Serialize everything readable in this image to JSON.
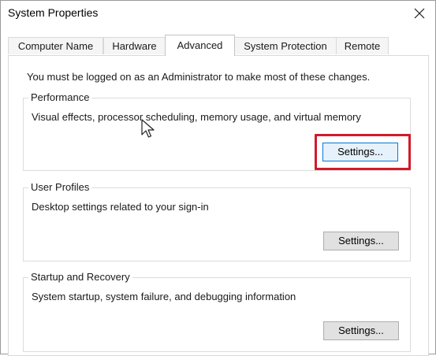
{
  "window": {
    "title": "System Properties"
  },
  "tabs": [
    {
      "label": "Computer Name"
    },
    {
      "label": "Hardware"
    },
    {
      "label": "Advanced"
    },
    {
      "label": "System Protection"
    },
    {
      "label": "Remote"
    }
  ],
  "active_tab": "Advanced",
  "note": "You must be logged on as an Administrator to make most of these changes.",
  "groups": {
    "performance": {
      "label": "Performance",
      "description": "Visual effects, processor scheduling, memory usage, and virtual memory",
      "button": "Settings..."
    },
    "user_profiles": {
      "label": "User Profiles",
      "description": "Desktop settings related to your sign-in",
      "button": "Settings..."
    },
    "startup_recovery": {
      "label": "Startup and Recovery",
      "description": "System startup, system failure, and debugging information",
      "button": "Settings..."
    }
  },
  "colors": {
    "highlight": "#d11a2a",
    "focus_border": "#0078d7"
  },
  "icons": {
    "close": "close-icon",
    "cursor": "mouse-pointer-icon"
  }
}
